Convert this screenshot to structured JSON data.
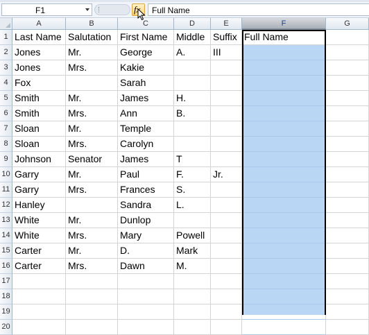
{
  "name_box": {
    "value": "F1"
  },
  "formula_bar": {
    "fx_label": "fx",
    "content": "Full Name"
  },
  "columns": [
    "A",
    "B",
    "C",
    "D",
    "E",
    "F",
    "G"
  ],
  "selected_column": "F",
  "row_numbers": [
    "1",
    "2",
    "3",
    "4",
    "5",
    "6",
    "7",
    "8",
    "9",
    "10",
    "11",
    "12",
    "13",
    "14",
    "15",
    "16",
    "17",
    "18",
    "19",
    "20"
  ],
  "rows": [
    [
      "Last Name",
      "Salutation",
      "First Name",
      "Middle",
      "Suffix",
      "Full Name",
      ""
    ],
    [
      "Jones",
      "Mr.",
      "George",
      "A.",
      "III",
      "",
      ""
    ],
    [
      "Jones",
      "Mrs.",
      "Kakie",
      "",
      "",
      "",
      ""
    ],
    [
      "Fox",
      "",
      "Sarah",
      "",
      "",
      "",
      ""
    ],
    [
      "Smith",
      "Mr.",
      "James",
      "H.",
      "",
      "",
      ""
    ],
    [
      "Smith",
      "Mrs.",
      "Ann",
      "B.",
      "",
      "",
      ""
    ],
    [
      "Sloan",
      "Mr.",
      "Temple",
      "",
      "",
      "",
      ""
    ],
    [
      "Sloan",
      "Mrs.",
      "Carolyn",
      "",
      "",
      "",
      ""
    ],
    [
      "Johnson",
      "Senator",
      "James",
      "T",
      "",
      "",
      ""
    ],
    [
      "Garry",
      "Mr.",
      "Paul",
      "F.",
      "Jr.",
      "",
      ""
    ],
    [
      "Garry",
      "Mrs.",
      "Frances",
      "S.",
      "",
      "",
      ""
    ],
    [
      "Hanley",
      "",
      "Sandra",
      "L.",
      "",
      "",
      ""
    ],
    [
      "White",
      "Mr.",
      "Dunlop",
      "",
      "",
      "",
      ""
    ],
    [
      "White",
      "Mrs.",
      "Mary",
      "Powell",
      "",
      "",
      ""
    ],
    [
      "Carter",
      "Mr.",
      "D.",
      "Mark",
      "",
      "",
      ""
    ],
    [
      "Carter",
      "Mrs.",
      "Dawn",
      "M.",
      "",
      "",
      ""
    ],
    [
      "",
      "",
      "",
      "",
      "",
      "",
      ""
    ],
    [
      "",
      "",
      "",
      "",
      "",
      "",
      ""
    ],
    [
      "",
      "",
      "",
      "",
      "",
      "",
      ""
    ],
    [
      "",
      "",
      "",
      "",
      "",
      "",
      ""
    ]
  ],
  "colors": {
    "selection": "#bad6f5",
    "header": "#e2e8f0",
    "fx_button": "#ffd47a"
  }
}
